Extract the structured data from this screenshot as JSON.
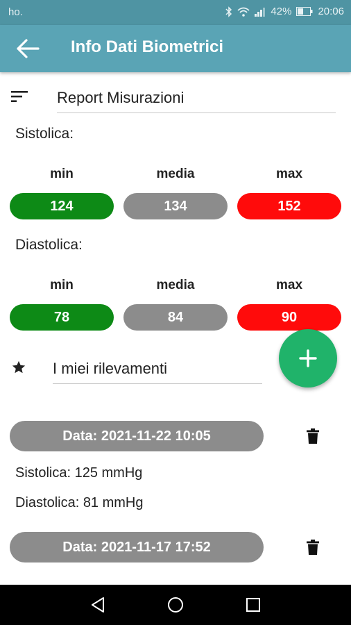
{
  "status_bar": {
    "carrier": "ho.",
    "battery_percent": "42%",
    "time": "20:06",
    "icons": [
      "bluetooth-icon",
      "wifi-icon",
      "signal-icon",
      "battery-icon"
    ]
  },
  "app_bar": {
    "title": "Info Dati Biometrici",
    "back_icon": "arrow-left-icon",
    "color": "#5aa4b5"
  },
  "report": {
    "icon": "sort-icon",
    "heading": "Report Misurazioni"
  },
  "systolic": {
    "label": "Sistolica:",
    "stats": [
      {
        "caption": "min",
        "value": "124",
        "color": "#0d8a16"
      },
      {
        "caption": "media",
        "value": "134",
        "color": "#8c8c8c"
      },
      {
        "caption": "max",
        "value": "152",
        "color": "#ff0b0b"
      }
    ]
  },
  "diastolic": {
    "label": "Diastolica:",
    "stats": [
      {
        "caption": "min",
        "value": "78",
        "color": "#0d8a16"
      },
      {
        "caption": "media",
        "value": "84",
        "color": "#8c8c8c"
      },
      {
        "caption": "max",
        "value": "90",
        "color": "#ff0b0b"
      }
    ]
  },
  "my_readings": {
    "icon": "star-icon",
    "heading": "I miei rilevamenti",
    "add_icon": "plus-icon",
    "fab_color": "#20b36a"
  },
  "readings": [
    {
      "date": "Data: 2021-11-22 10:05",
      "systolic": "Sistolica: 125 mmHg",
      "diastolic": "Diastolica: 81 mmHg",
      "delete_icon": "trash-icon"
    },
    {
      "date": "Data: 2021-11-17 17:52",
      "delete_icon": "trash-icon"
    }
  ],
  "nav_bar": {
    "icons": [
      "back-triangle-icon",
      "home-circle-icon",
      "recents-square-icon"
    ]
  }
}
